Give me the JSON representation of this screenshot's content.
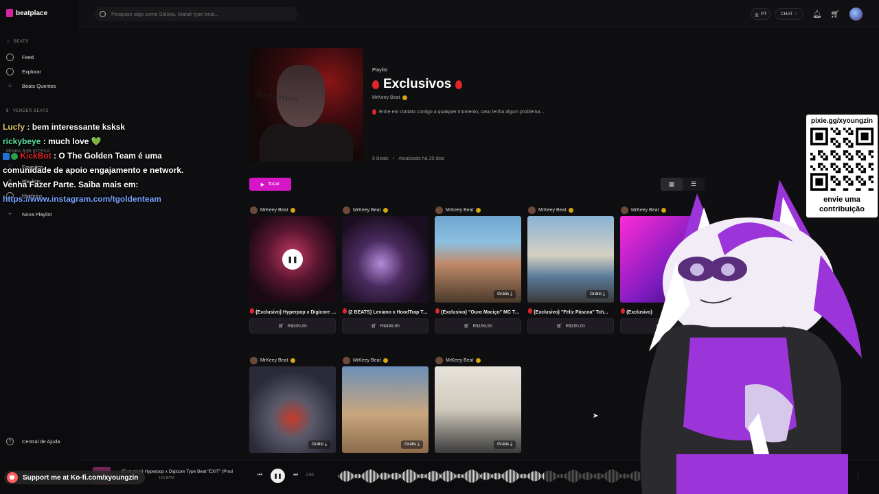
{
  "app": {
    "name": "beatplace"
  },
  "sidebar": {
    "beats_section": "BEATS",
    "beats_items": [
      {
        "label": "Feed",
        "icon": "compass-icon"
      },
      {
        "label": "Explorar",
        "icon": "search-icon"
      },
      {
        "label": "Beats Quentes",
        "icon": "flame-icon"
      }
    ],
    "sell_section": "VENDER BEATS",
    "library_section": "MINHA BIBLIOTECA",
    "library_items": [
      {
        "label": "Favoritos",
        "icon": "heart-icon"
      },
      {
        "label": "Playlists",
        "icon": "list-icon"
      },
      {
        "label": "Histórico",
        "icon": "history-icon"
      },
      {
        "label": "Nova Playlist",
        "icon": "plus-icon"
      }
    ],
    "help": "Central de Ajuda"
  },
  "topbar": {
    "search_placeholder": "Pesquise algo como Sidoka, Matuê type beat...",
    "lang": "PT",
    "chat": "CHAT"
  },
  "playlist": {
    "kind": "Playlist",
    "title": "Exclusivos",
    "author": "MrKeey Beat",
    "description": "Entre em contato comigo a qualquer momento, caso tenha algum problema...",
    "beats_count": "9 Beats",
    "updated": "Atualizado há 20 dias",
    "play_label": "Tocar"
  },
  "cards": [
    {
      "author": "MrKeey Beat",
      "title": "{Exclusivo} Hyperpop x Digicore Type Beat \"EXIT\"",
      "price": "R$300,00",
      "free": "",
      "playing": true
    },
    {
      "author": "MrKeey Beat",
      "title": "{2 BEATS} Leviano x HoodTrap Type Beat",
      "price": "R$499,90",
      "free": "",
      "playing": false
    },
    {
      "author": "MrKeey Beat",
      "title": "{Exclusivo} \"Ouro Maciço\" MC Type Beat",
      "price": "R$159,90",
      "free": "Grátis",
      "playing": false
    },
    {
      "author": "MrKeey Beat",
      "title": "{Exclusivo} \"Feliz Páscoa\" Tch...",
      "price": "R$150,00",
      "free": "Grátis",
      "playing": false
    },
    {
      "author": "MrKeey Beat",
      "title": "{Exclusivo} ",
      "price": "R$",
      "free": "",
      "playing": false
    },
    {
      "author": "MrKeey Beat",
      "title": "",
      "price": "",
      "free": "Grátis",
      "playing": false
    },
    {
      "author": "MrKeey Beat",
      "title": "",
      "price": "",
      "free": "Grátis",
      "playing": false
    },
    {
      "author": "MrKeey Beat",
      "title": "",
      "price": "",
      "free": "Grátis",
      "playing": false
    }
  ],
  "player": {
    "title": "{Exclusivo} Hyperpop x Digicore Type Beat \"EXIT\" (Prod",
    "bpm": "160 BPM",
    "time": "2:00"
  },
  "overlay": {
    "chat": [
      {
        "user": "Lucfy",
        "sep": " : ",
        "msg": "bem interessante ksksk"
      },
      {
        "user": "rickybeye",
        "sep": " : ",
        "msg": "much love 💚"
      },
      {
        "user": "KickBot",
        "sep": " : ",
        "msg": "O The Golden Team é uma comunidade de apoio engajamento e network. Venha Fazer Parte. Saiba mais em:"
      },
      {
        "link": "https://www.instagram.com/tgoldenteam"
      }
    ],
    "qr_url": "pixie.gg/xyoungzin",
    "qr_cta_1": "envie uma",
    "qr_cta_2": "contribuição",
    "kofi": "Support me at Ko-fi.com/xyoungzin"
  },
  "colors": {
    "accent": "#d616c6",
    "drop": "#e0252b",
    "badge": "#d4a514",
    "mascot_purple": "#9b34d9"
  }
}
